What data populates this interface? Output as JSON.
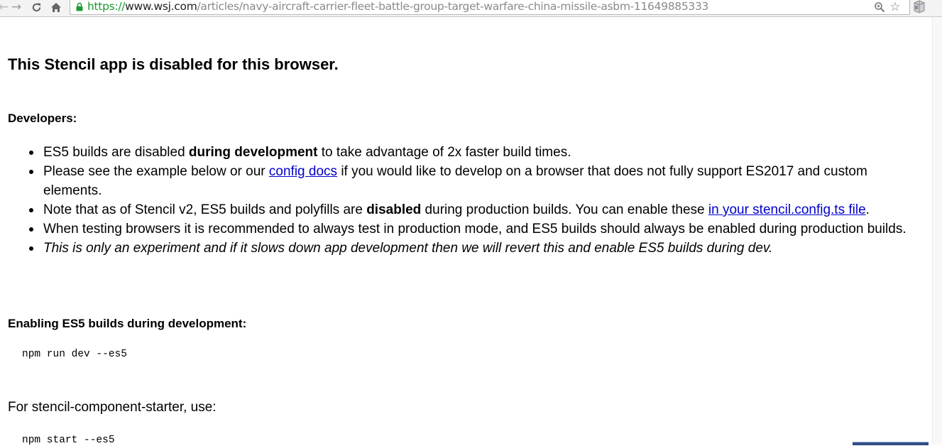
{
  "browser": {
    "url_scheme": "https://",
    "url_host": "www.wsj.com",
    "url_path": "/articles/navy-aircraft-carrier-fleet-battle-group-target-warfare-china-missile-asbm-11649885333",
    "icons": {
      "back": "back-arrow-icon",
      "forward": "forward-arrow-icon",
      "reload": "reload-icon",
      "home": "home-icon",
      "lock": "lock-icon",
      "zoom": "zoom-icon",
      "bookmark": "star-icon",
      "extension": "extension-icon"
    },
    "colors": {
      "secure": "#189a2e",
      "link": "#0000cc"
    }
  },
  "page": {
    "title": "This Stencil app is disabled for this browser.",
    "developers_heading": "Developers:",
    "bullets": {
      "b1": {
        "text_before": "ES5 builds are disabled ",
        "bold": "during development",
        "text_after": " to take advantage of 2x faster build times."
      },
      "b2": {
        "text_before": "Please see the example below or our ",
        "link": "config docs",
        "text_after": " if you would like to develop on a browser that does not fully support ES2017 and custom elements."
      },
      "b3": {
        "text_before": "Note that as of Stencil v2, ES5 builds and polyfills are ",
        "bold": "disabled",
        "text_mid": " during production builds. You can enable these ",
        "link": "in your stencil.config.ts file",
        "text_after": "."
      },
      "b4": {
        "text": "When testing browsers it is recommended to always test in production mode, and ES5 builds should always be enabled during production builds."
      },
      "b5": {
        "italic": "This is only an experiment and if it slows down app development then we will revert this and enable ES5 builds during dev."
      }
    },
    "enabling_heading": "Enabling ES5 builds during development:",
    "dev_command": "npm run dev --es5",
    "starter_text": "For stencil-component-starter, use:",
    "start_command": "npm start --es5"
  }
}
